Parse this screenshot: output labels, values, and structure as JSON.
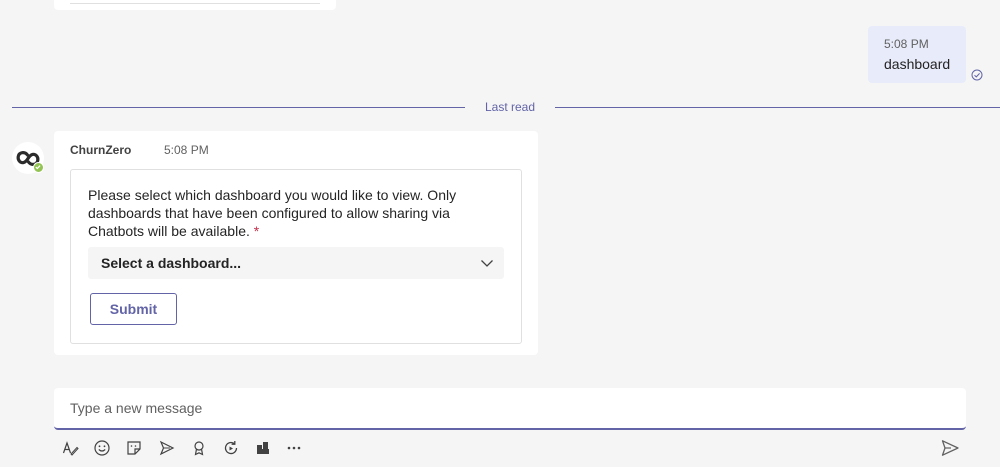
{
  "sent_message": {
    "time": "5:08 PM",
    "text": "dashboard",
    "status_icon": "read-check-icon"
  },
  "divider": {
    "label": "Last read"
  },
  "bot_message": {
    "sender": "ChurnZero",
    "time": "5:08 PM",
    "avatar_icon": "churnzero-logo-icon",
    "presence": "available",
    "card": {
      "prompt": "Please select which dashboard you would like to view. Only dashboards that have been configured to allow sharing via Chatbots will be available.",
      "required_marker": "*",
      "select_value": "Select a dashboard...",
      "submit_label": "Submit"
    }
  },
  "composer": {
    "placeholder": "Type a new message",
    "tools": [
      "format-icon",
      "emoji-icon",
      "sticker-icon",
      "loop-icon",
      "praise-icon",
      "refresh-icon",
      "apps-icon",
      "more-icon"
    ],
    "send_icon": "send-icon"
  },
  "colors": {
    "accent": "#6264a7",
    "my_bubble": "#e8ebfa",
    "presence_available": "#92c353",
    "required": "#c4314b"
  }
}
